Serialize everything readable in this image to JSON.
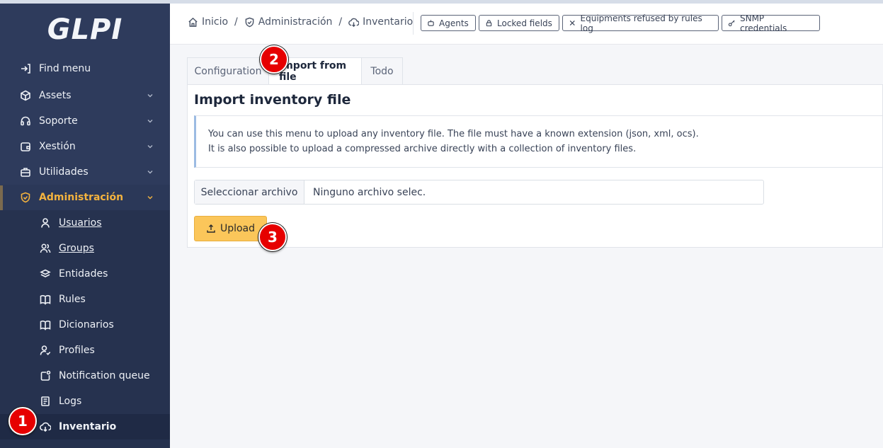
{
  "app": {
    "logo_text": "GLPI"
  },
  "sidebar": {
    "items": [
      {
        "label": "Find menu",
        "icon": "arrow-right-to-bracket-icon"
      },
      {
        "label": "Assets",
        "icon": "cube-icon"
      },
      {
        "label": "Soporte",
        "icon": "headset-icon"
      },
      {
        "label": "Xestión",
        "icon": "wallet-icon"
      },
      {
        "label": "Utilidades",
        "icon": "briefcase-icon"
      },
      {
        "label": "Administración",
        "icon": "shield-check-icon"
      }
    ],
    "submenu": [
      {
        "label": "Usuarios",
        "icon": "user-icon"
      },
      {
        "label": "Groups",
        "icon": "users-icon"
      },
      {
        "label": "Entidades",
        "icon": "stack-icon"
      },
      {
        "label": "Rules",
        "icon": "book-icon"
      },
      {
        "label": "Dicionarios",
        "icon": "book-icon"
      },
      {
        "label": "Profiles",
        "icon": "user-check-icon"
      },
      {
        "label": "Notification queue",
        "icon": "notification-icon"
      },
      {
        "label": "Logs",
        "icon": "news-icon"
      },
      {
        "label": "Inventario",
        "icon": "cloud-download-icon"
      }
    ]
  },
  "breadcrumb": {
    "home": "Inicio",
    "admin": "Administración",
    "inventory": "Inventario"
  },
  "header_buttons": [
    {
      "label": "Agents",
      "icon": "robot-icon"
    },
    {
      "label": "Locked fields",
      "icon": "lock-icon"
    },
    {
      "label": "Equipments refused by rules log",
      "icon": "x-icon"
    },
    {
      "label": "SNMP credentials",
      "icon": "key-icon"
    }
  ],
  "tabs": [
    {
      "label": "Configuration"
    },
    {
      "label": "Import from file"
    },
    {
      "label": "Todo"
    }
  ],
  "panel": {
    "title": "Import inventory file",
    "alert_line1": "You can use this menu to upload any inventory file. The file must have a known extension (json, xml, ocs).",
    "alert_line2": "It is also possible to upload a compressed archive directly with a collection of inventory files.",
    "file_button": "Seleccionar archivo",
    "file_name": "Ninguno archivo selec.",
    "upload_label": "Upload"
  },
  "markers": [
    "1",
    "2",
    "3"
  ],
  "colors": {
    "sidebar_bg": "#2e3b5c",
    "accent": "#f4b33e",
    "upload_bg": "#fbc65a",
    "marker": "#e60000"
  }
}
